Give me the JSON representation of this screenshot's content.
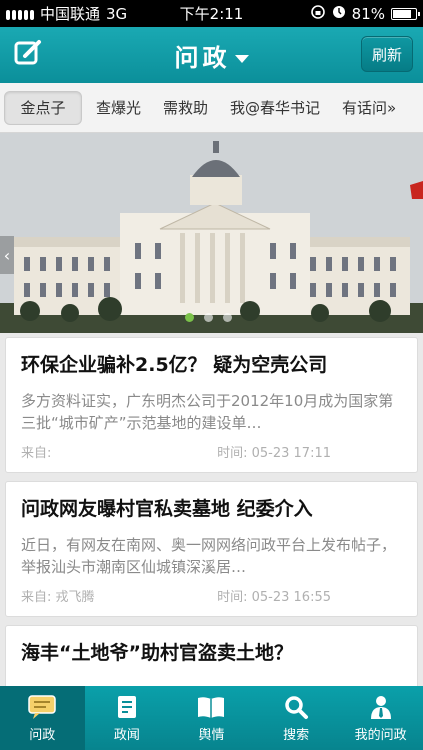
{
  "status_bar": {
    "carrier": "中国联通",
    "network": "3G",
    "time": "下午2:11",
    "battery": "81%",
    "battery_level": 0.81
  },
  "header": {
    "title": "问政",
    "refresh_label": "刷新"
  },
  "tabs": [
    {
      "label": "金点子"
    },
    {
      "label": "查爆光"
    },
    {
      "label": "需救助"
    },
    {
      "label": "我@春华书记"
    },
    {
      "label": "有话问»"
    }
  ],
  "articles": [
    {
      "title": "环保企业骗补2.5亿？ 疑为空壳公司",
      "summary": "多方资料证实，广东明杰公司于2012年10月成为国家第三批“城市矿产”示范基地的建设单…",
      "source": "来自:",
      "time": "时间: 05-23 17:11"
    },
    {
      "title": "问政网友曝村官私卖墓地 纪委介入",
      "summary": "近日，有网友在南网、奥一网网络问政平台上发布帖子，举报汕头市潮南区仙城镇深溪居…",
      "source": "来自: 戎飞腾",
      "time": "时间: 05-23 16:55"
    },
    {
      "title": "海丰“土地爷”助村官盗卖土地？",
      "summary": "",
      "source": "",
      "time": ""
    }
  ],
  "bottom_nav": [
    {
      "label": "问政",
      "icon": "chat-bubble-icon"
    },
    {
      "label": "政闻",
      "icon": "document-icon"
    },
    {
      "label": "舆情",
      "icon": "book-icon"
    },
    {
      "label": "搜索",
      "icon": "search-icon"
    },
    {
      "label": "我的问政",
      "icon": "user-icon"
    }
  ],
  "colors": {
    "brand": "#0b8f9a",
    "nav_active": "#056d76"
  }
}
